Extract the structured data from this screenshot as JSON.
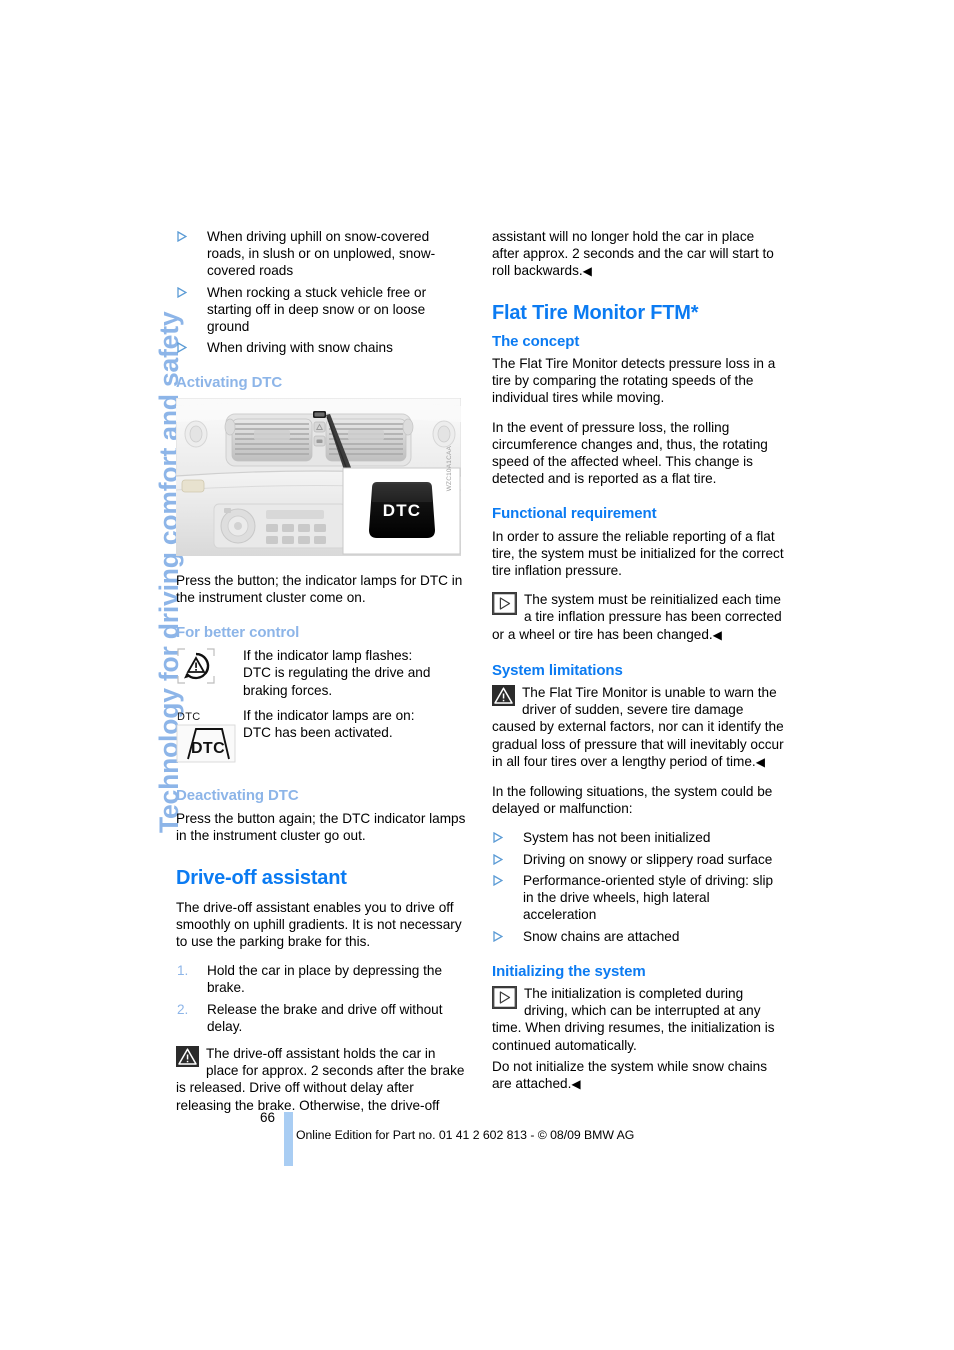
{
  "chapter_tab": {
    "label": "Technology for driving comfort and safety",
    "color": "#8db5e8"
  },
  "colors": {
    "heading_main": "#0b7bf2",
    "heading_sub_light": "#8db5e8",
    "heading_sub_dark": "#0b7bf2",
    "bullet_marker": "#5b9bd5",
    "footer_bar": "#a9cdf3",
    "body_text": "#000000"
  },
  "left_column": {
    "dtc_conditions": [
      "When driving uphill on snow-covered roads, in slush or on unplowed, snow-covered roads",
      "When rocking a stuck vehicle free or starting off in deep snow or on loose ground",
      "When driving with snow chains"
    ],
    "activating_heading": "Activating DTC",
    "photo": {
      "alt": "Dashboard center vents with DTC button, inset close-up of the DTC button",
      "button_label": "DTC",
      "image_code": "WZC10A1CAA"
    },
    "activating_text": "Press the button; the indicator lamps for DTC in the instrument cluster come on.",
    "better_control_heading": "For better control",
    "lamps": [
      {
        "icon": "dtc-flashing-lamp-icon",
        "line1": "If the indicator lamp flashes:",
        "line2": "DTC is regulating the drive and braking forces."
      },
      {
        "icon": "dtc-on-lamp-icon",
        "icon_caption": "DTC",
        "icon_label": "DTC",
        "line1": "If the indicator lamps are on:",
        "line2": "DTC has been activated."
      }
    ],
    "deactivating_heading": "Deactivating DTC",
    "deactivating_text": "Press the button again; the DTC indicator lamps in the instrument cluster go out.",
    "driveoff_title": "Drive-off assistant",
    "driveoff_intro": "The drive-off assistant enables you to drive off smoothly on uphill gradients. It is not necessary to use the parking brake for this.",
    "driveoff_steps": [
      {
        "number": "1.",
        "text": "Hold the car in place by depressing the brake."
      },
      {
        "number": "2.",
        "text": "Release the brake and drive off without delay."
      }
    ],
    "driveoff_warning": "The drive-off assistant holds the car in place for approx. 2 seconds after the brake is released. Drive off without delay after releasing the brake. Otherwise, the drive-off"
  },
  "right_column": {
    "continued_text": "assistant will no longer hold the car in place after approx. 2 seconds and the car will start to roll backwards.",
    "ftm_title": "Flat Tire Monitor FTM*",
    "concept_heading": "The concept",
    "concept_p1": "The Flat Tire Monitor detects pressure loss in a tire by comparing the rotating speeds of the individual tires while moving.",
    "concept_p2": "In the event of pressure loss, the rolling circumference changes and, thus, the rotating speed of the affected wheel. This change is detected and is reported as a flat tire.",
    "functional_heading": "Functional requirement",
    "functional_p1": "In order to assure the reliable reporting of a flat tire, the system must be initialized for the correct tire inflation pressure.",
    "functional_note": "The system must be reinitialized each time a tire inflation pressure has been corrected or a wheel or tire has been changed.",
    "limitations_heading": "System limitations",
    "limitations_warning": "The Flat Tire Monitor is unable to warn the driver of sudden, severe tire damage caused by external factors, nor can it identify the gradual loss of pressure that will inevitably occur in all four tires over a lengthy period of time.",
    "limitations_intro": "In the following situations, the system could be delayed or malfunction:",
    "limitations_items": [
      "System has not been initialized",
      "Driving on snowy or slippery road surface",
      "Performance-oriented style of driving: slip in the drive wheels, high lateral acceleration",
      "Snow chains are attached"
    ],
    "initializing_heading": "Initializing the system",
    "initializing_note": "The initialization is completed during driving, which can be interrupted at any time. When driving resumes, the initialization is continued automatically.",
    "initializing_p2": "Do not initialize the system while snow chains are attached."
  },
  "footer": {
    "page_number": "66",
    "text": "Online Edition for Part no. 01 41 2 602 813 - © 08/09 BMW AG"
  },
  "symbols": {
    "end_mark": "◀"
  }
}
